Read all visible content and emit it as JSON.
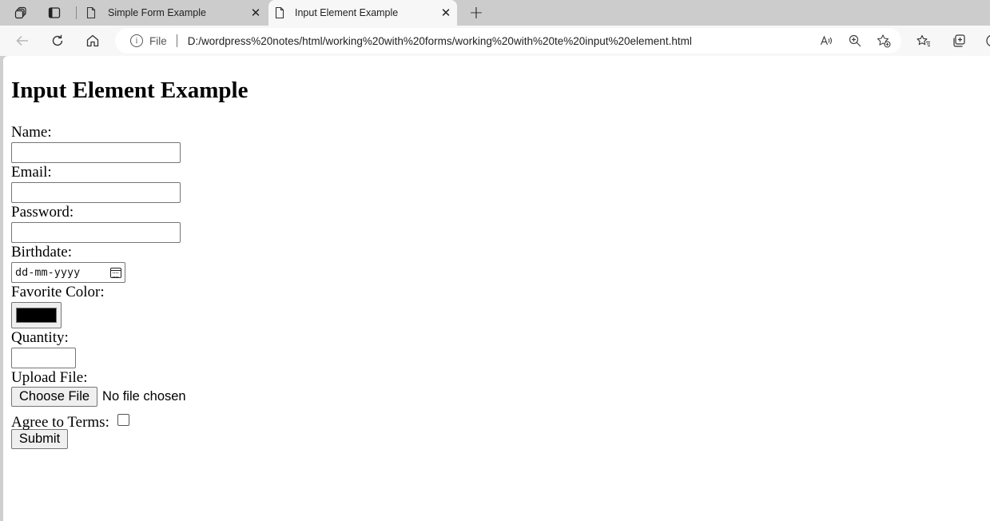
{
  "browser": {
    "tabs": [
      {
        "title": "Simple Form Example",
        "active": false
      },
      {
        "title": "Input Element Example",
        "active": true
      }
    ],
    "address": {
      "scheme_label": "File",
      "url": "D:/wordpress%20notes/html/working%20with%20forms/working%20with%20te%20input%20element.html"
    },
    "icons": {
      "workspaces": "workspaces-icon",
      "tab_actions": "tab-actions-icon",
      "back": "back-arrow-icon",
      "refresh": "refresh-icon",
      "home": "home-icon",
      "site_info": "info-icon",
      "read_aloud": "read-aloud-icon",
      "zoom": "zoom-icon",
      "add_favorite": "add-favorite-icon",
      "favorites": "favorites-icon",
      "collections": "collections-icon"
    }
  },
  "page": {
    "heading": "Input Element Example",
    "form": {
      "name_label": "Name:",
      "email_label": "Email:",
      "password_label": "Password:",
      "birthdate_label": "Birthdate:",
      "birthdate_placeholder": "dd-mm-yyyy",
      "color_label": "Favorite Color:",
      "color_value": "#000000",
      "quantity_label": "Quantity:",
      "upload_label": "Upload File:",
      "choose_file_label": "Choose File",
      "file_status": "No file chosen",
      "agree_label": "Agree to Terms:",
      "submit_label": "Submit"
    }
  }
}
